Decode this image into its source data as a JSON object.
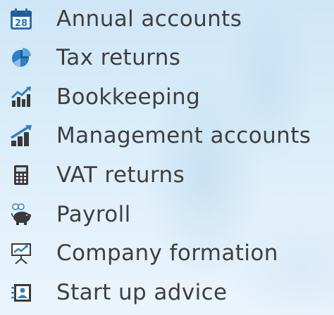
{
  "services": [
    {
      "label": "Annual accounts",
      "icon": "calendar-icon",
      "calendar_day": "28"
    },
    {
      "label": "Tax returns",
      "icon": "pie-chart-icon"
    },
    {
      "label": "Bookkeeping",
      "icon": "growth-chart-icon"
    },
    {
      "label": "Management accounts",
      "icon": "trend-bars-icon"
    },
    {
      "label": "VAT returns",
      "icon": "calculator-icon"
    },
    {
      "label": "Payroll",
      "icon": "piggy-bank-icon"
    },
    {
      "label": "Company formation",
      "icon": "presentation-board-icon"
    },
    {
      "label": "Start up advice",
      "icon": "contact-card-icon"
    }
  ],
  "colors": {
    "text": "#3f3f3f",
    "icon_blue": "#2f7fc4",
    "icon_dark": "#3a3a3a",
    "calendar_red": "#c84b3b"
  }
}
